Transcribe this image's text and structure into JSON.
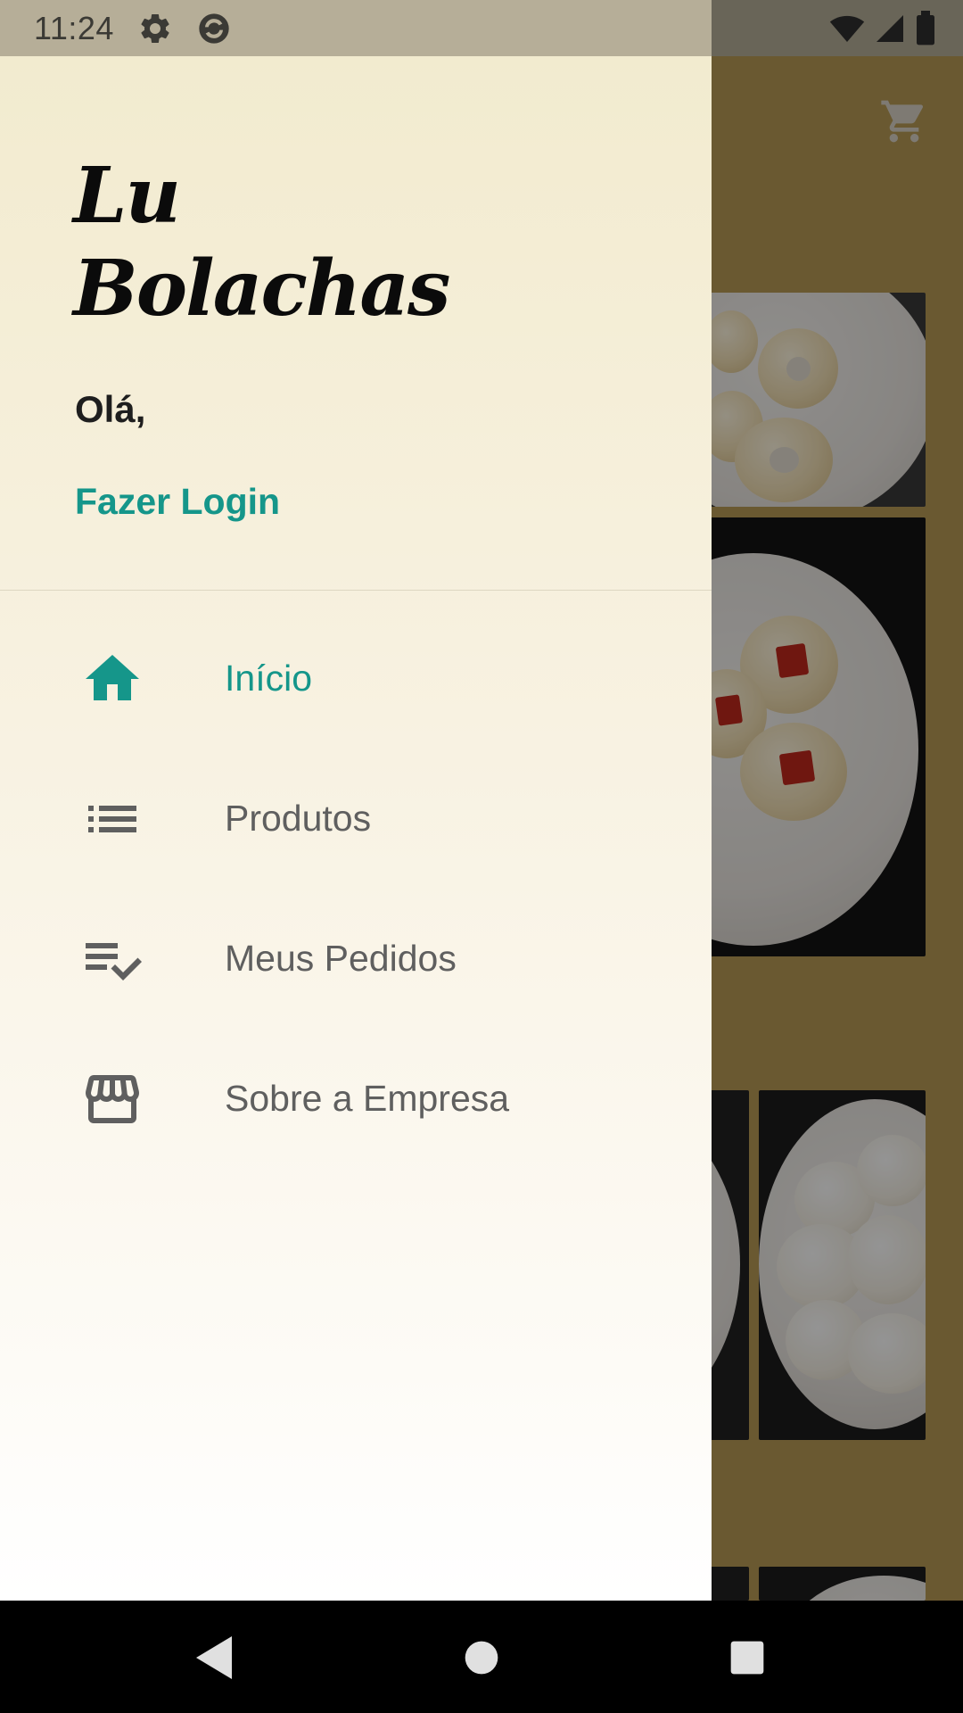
{
  "status_bar": {
    "time": "11:24",
    "left_icons": [
      "settings-icon",
      "sync-icon"
    ],
    "right_icons": [
      "wifi-icon",
      "cell-signal-icon",
      "battery-icon"
    ]
  },
  "app_background": {
    "cart_icon": "shopping-cart-icon"
  },
  "drawer": {
    "brand": "Lu Bolachas",
    "brand_line1": "Lu",
    "brand_line2": "Bolachas",
    "greeting": "Olá,",
    "login_label": "Fazer Login",
    "accent_color": "#15968a",
    "menu": [
      {
        "label": "Início",
        "icon": "home-icon",
        "active": true
      },
      {
        "label": "Produtos",
        "icon": "list-icon",
        "active": false
      },
      {
        "label": "Meus Pedidos",
        "icon": "playlist-check-icon",
        "active": false
      },
      {
        "label": "Sobre a Empresa",
        "icon": "storefront-icon",
        "active": false
      }
    ]
  },
  "nav_bar": {
    "buttons": [
      "back-icon",
      "home-circle-icon",
      "recents-icon"
    ]
  }
}
